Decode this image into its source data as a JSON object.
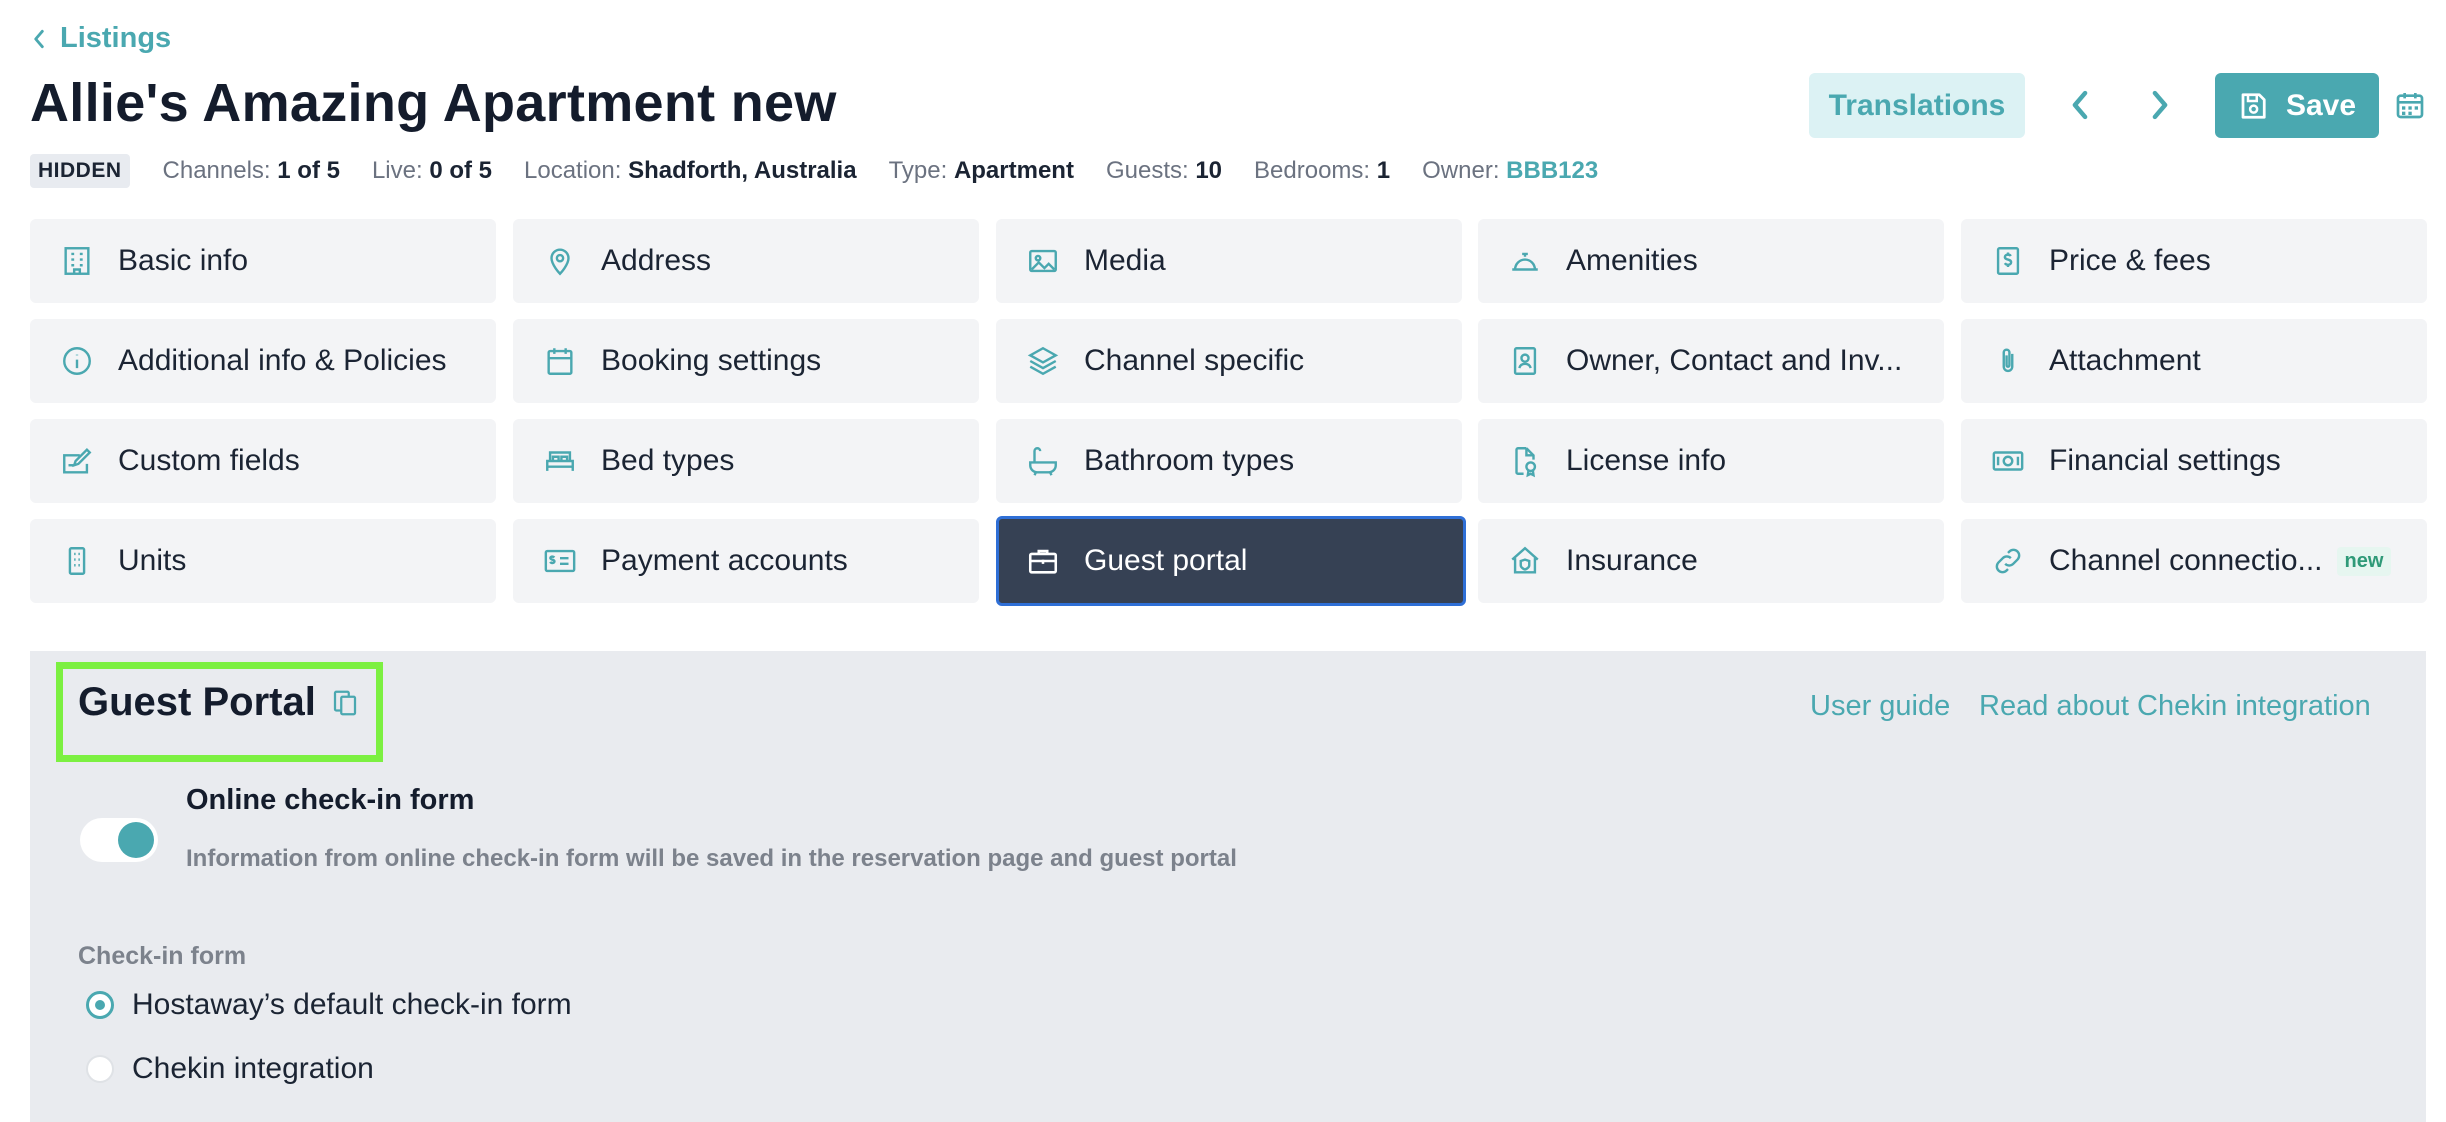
{
  "back": {
    "label": "Listings"
  },
  "title": "Allie's Amazing Apartment new",
  "actions": {
    "translations": "Translations",
    "save": "Save"
  },
  "meta": {
    "status": "HIDDEN",
    "channels_label": "Channels:",
    "channels_value": "1 of 5",
    "live_label": "Live:",
    "live_value": "0 of 5",
    "location_label": "Location:",
    "location_value": "Shadforth, Australia",
    "type_label": "Type:",
    "type_value": "Apartment",
    "guests_label": "Guests:",
    "guests_value": "10",
    "bedrooms_label": "Bedrooms:",
    "bedrooms_value": "1",
    "owner_label": "Owner:",
    "owner_value": "BBB123"
  },
  "tiles": [
    {
      "label": "Basic info",
      "icon": "building-icon"
    },
    {
      "label": "Address",
      "icon": "map-pin-icon"
    },
    {
      "label": "Media",
      "icon": "image-icon"
    },
    {
      "label": "Amenities",
      "icon": "service-bell-icon"
    },
    {
      "label": "Price & fees",
      "icon": "dollar-icon"
    },
    {
      "label": "Additional info & Policies",
      "icon": "info-icon"
    },
    {
      "label": "Booking settings",
      "icon": "calendar-icon"
    },
    {
      "label": "Channel specific",
      "icon": "layers-icon"
    },
    {
      "label": "Owner, Contact and Inv...",
      "icon": "contact-card-icon"
    },
    {
      "label": "Attachment",
      "icon": "paperclip-icon"
    },
    {
      "label": "Custom fields",
      "icon": "edit-field-icon"
    },
    {
      "label": "Bed types",
      "icon": "bed-icon"
    },
    {
      "label": "Bathroom types",
      "icon": "bathtub-icon"
    },
    {
      "label": "License info",
      "icon": "license-icon"
    },
    {
      "label": "Financial settings",
      "icon": "banknote-icon"
    },
    {
      "label": "Units",
      "icon": "units-icon"
    },
    {
      "label": "Payment accounts",
      "icon": "payment-card-icon"
    },
    {
      "label": "Guest portal",
      "icon": "briefcase-icon",
      "active": true
    },
    {
      "label": "Insurance",
      "icon": "house-shield-icon"
    },
    {
      "label": "Channel connectio...",
      "icon": "link-icon",
      "badge": "new"
    }
  ],
  "guest_portal": {
    "title": "Guest Portal",
    "user_guide": "User guide",
    "read_about": "Read about Chekin integration",
    "online_checkin_title": "Online check-in form",
    "online_checkin_desc": "Information from online check-in form will be saved in the reservation page and guest portal",
    "online_checkin_enabled": true,
    "checkin_form_label": "Check-in form",
    "options": [
      {
        "label": "Hostaway’s default check-in form",
        "selected": true
      },
      {
        "label": "Chekin integration",
        "selected": false
      }
    ]
  },
  "colors": {
    "accent": "#4aa8b0",
    "active_tile": "#364154",
    "highlight": "#7cf041"
  }
}
